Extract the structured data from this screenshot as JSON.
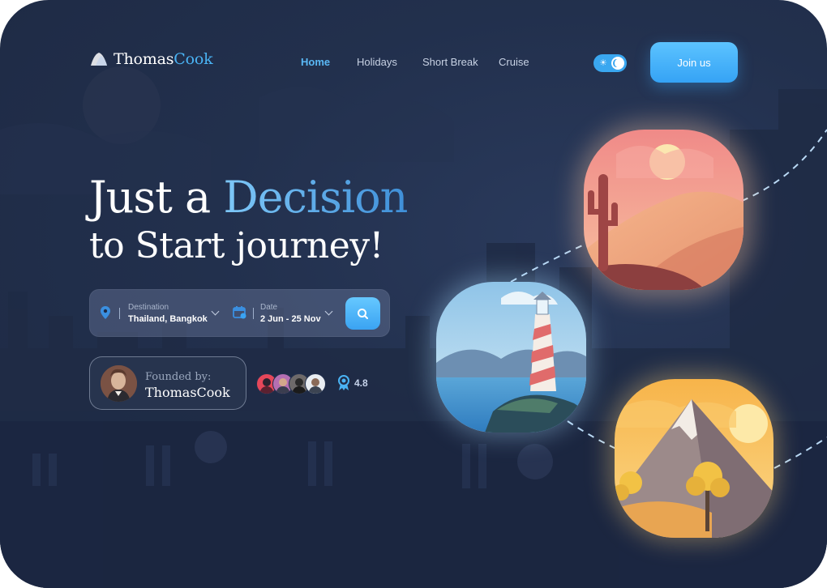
{
  "brand": {
    "name_part1": "Thomas",
    "name_part2": "Cook"
  },
  "nav": {
    "items": [
      "Home",
      "Holidays",
      "Short Break",
      "Cruise"
    ],
    "active": "Home"
  },
  "theme_toggle": {
    "state": "dark"
  },
  "join_label": "Join us",
  "hero": {
    "line1_part1": "Just a ",
    "line1_accent": "Decision",
    "line2": "to Start journey!"
  },
  "search": {
    "destination_label": "Destination",
    "destination_value": "Thailand, Bangkok",
    "date_label": "Date",
    "date_value": "2 Jun - 25 Nov"
  },
  "founded": {
    "label": "Founded by:",
    "name": "ThomasCook"
  },
  "rating": {
    "value": "4.8"
  },
  "colors": {
    "accent": "#4ab3f4",
    "background": "#22304d",
    "button": "#3aa3f2"
  },
  "icons": [
    "logo-icon",
    "sun-icon",
    "moon-icon",
    "location-pin-icon",
    "calendar-icon",
    "chevron-down-icon",
    "search-icon",
    "award-icon"
  ],
  "destinations": [
    "desert",
    "lighthouse",
    "mountain"
  ]
}
